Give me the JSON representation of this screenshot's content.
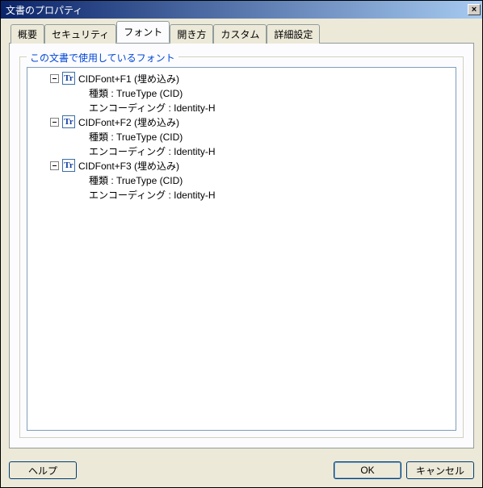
{
  "window": {
    "title": "文書のプロパティ",
    "close_glyph": "×"
  },
  "tabs": [
    {
      "label": "概要"
    },
    {
      "label": "セキュリティ"
    },
    {
      "label": "フォント"
    },
    {
      "label": "開き方"
    },
    {
      "label": "カスタム"
    },
    {
      "label": "詳細設定"
    }
  ],
  "group": {
    "legend": "この文書で使用しているフォント"
  },
  "fonts": [
    {
      "name": "CIDFont+F1 (埋め込み)",
      "type_line": "種類 : TrueType (CID)",
      "enc_line": "エンコーディング : Identity-H",
      "icon_glyph": "Tr"
    },
    {
      "name": "CIDFont+F2 (埋め込み)",
      "type_line": "種類 : TrueType (CID)",
      "enc_line": "エンコーディング : Identity-H",
      "icon_glyph": "Tr"
    },
    {
      "name": "CIDFont+F3 (埋め込み)",
      "type_line": "種類 : TrueType (CID)",
      "enc_line": "エンコーディング : Identity-H",
      "icon_glyph": "Tr"
    }
  ],
  "buttons": {
    "help": "ヘルプ",
    "ok": "OK",
    "cancel": "キャンセル"
  }
}
